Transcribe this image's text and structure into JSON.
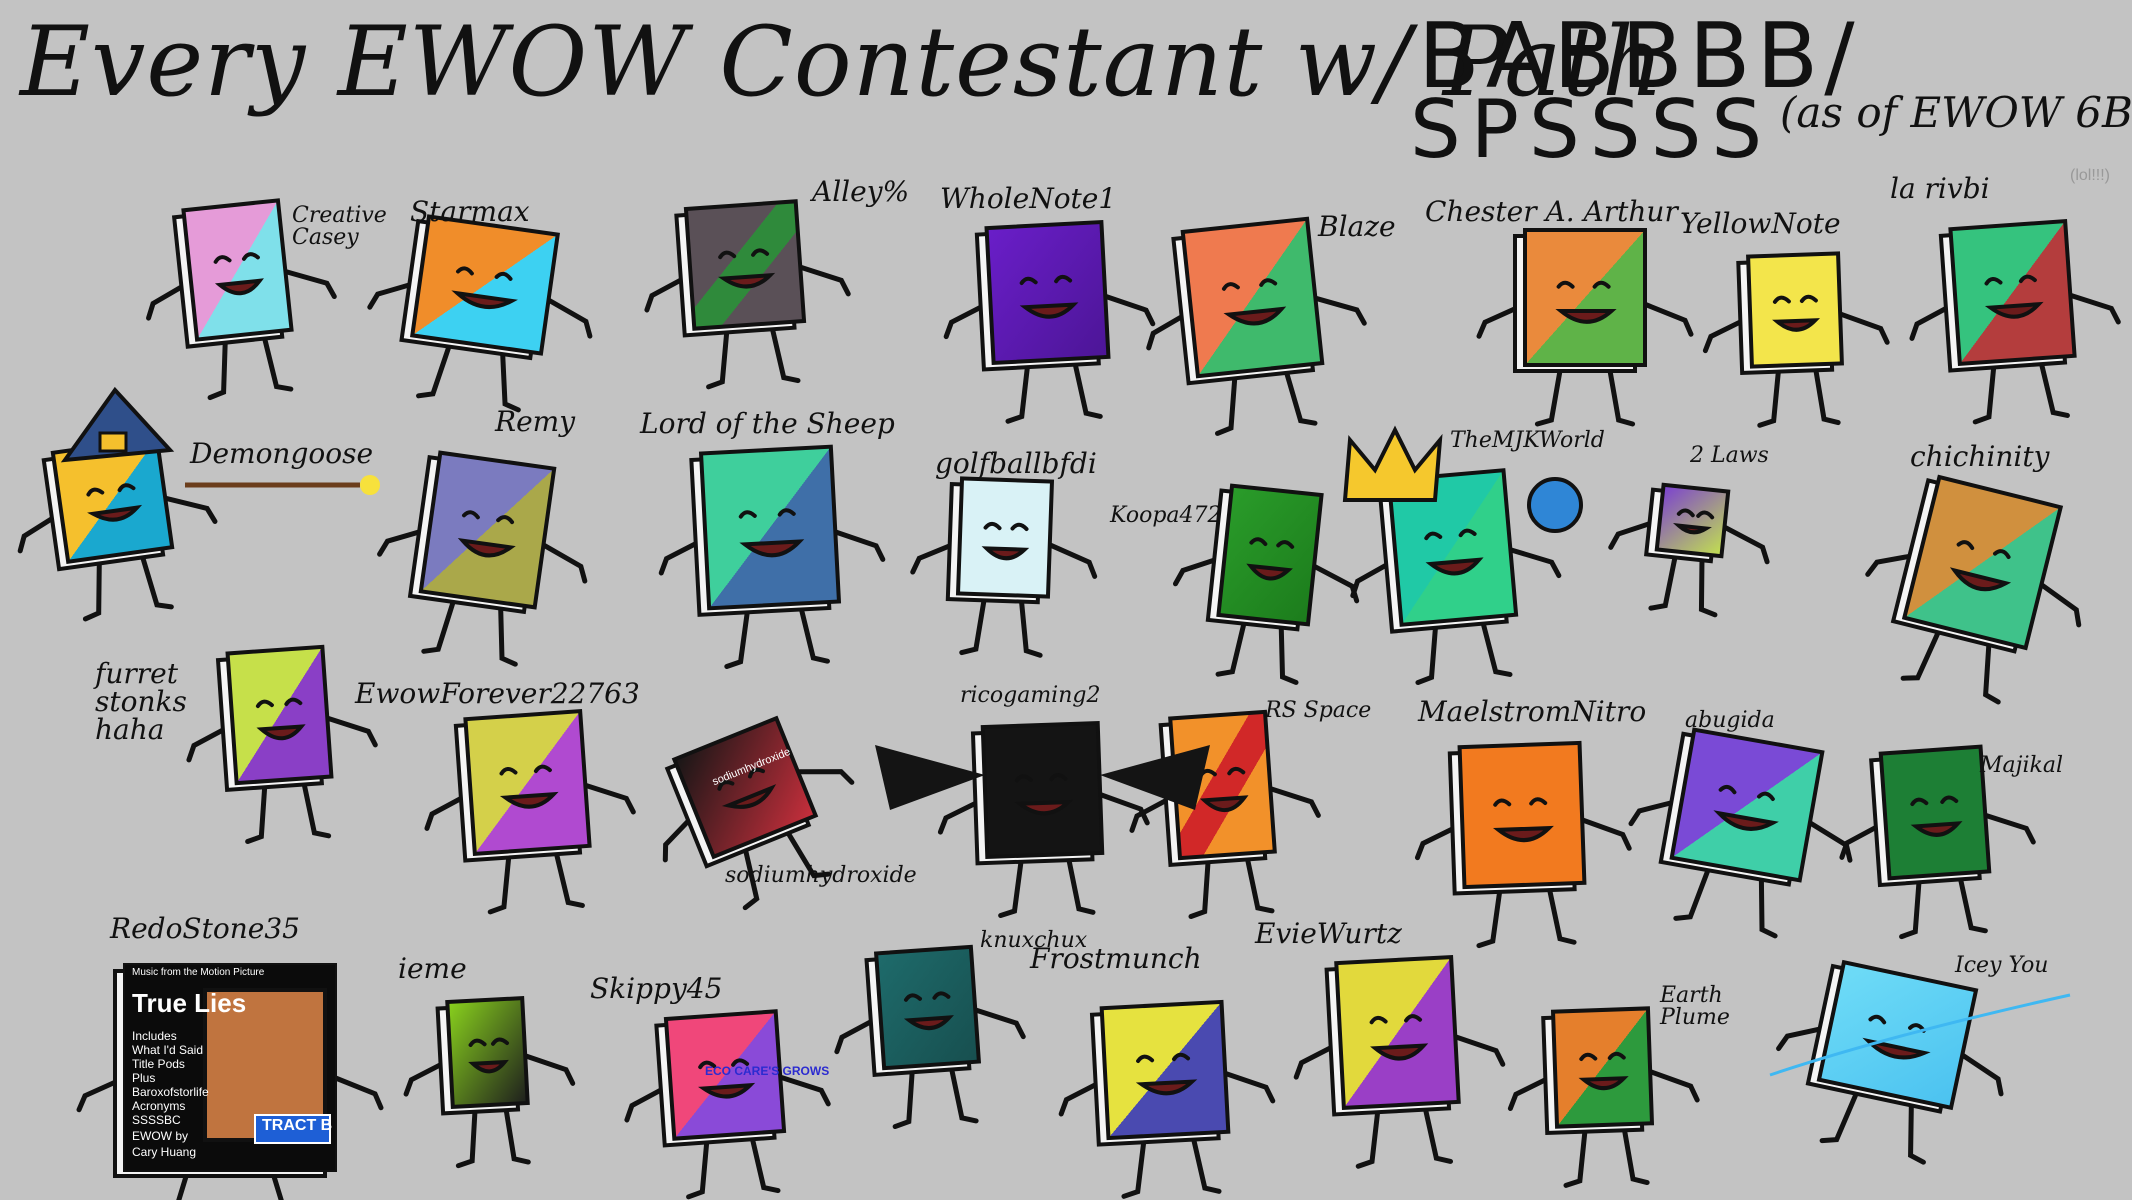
{
  "title": {
    "line1": "Every EWOW Contestant w/ Path",
    "path_top": "BABBBB/",
    "path_bottom": "SPSSSS",
    "note": "(as of EWOW 6B)"
  },
  "extra_text": {
    "lol": "(lol!!!)",
    "cover_line1": "Music from the Motion Picture",
    "cover_title": "True Lies",
    "cover_body": [
      "Includes",
      "What I'd Said",
      "Title Pods",
      "Plus",
      "Baroxofstorlife",
      "Acronyms",
      "SSSSBC"
    ],
    "cover_footer": [
      "EWOW by",
      "Cary Huang"
    ],
    "tract_badge": "TRACT B",
    "skippy_cover": "ECO CARE'S GROWS",
    "sodium_cover": "sodiumhydroxide"
  },
  "characters": [
    {
      "id": "creative-casey",
      "label": "Creative\nCasey",
      "colors": [
        "#e59bd8",
        "#7fe0ea"
      ],
      "split": "diag"
    },
    {
      "id": "starmax",
      "label": "Starmax",
      "colors": [
        "#f08d2a",
        "#3dd1f2"
      ],
      "split": "diag"
    },
    {
      "id": "alley",
      "label": "Alley%",
      "colors": [
        "#5a5057",
        "#2f8a3b"
      ],
      "split": "band"
    },
    {
      "id": "wholenote1",
      "label": "WholeNote1",
      "colors": [
        "#6a1ec9",
        "#4c1596"
      ],
      "split": "solid"
    },
    {
      "id": "blaze",
      "label": "Blaze",
      "colors": [
        "#ef7a4f",
        "#3fba6c"
      ],
      "split": "diag"
    },
    {
      "id": "chester",
      "label": "Chester A. Arthur",
      "colors": [
        "#ea8a3c",
        "#5fb348"
      ],
      "split": "diag"
    },
    {
      "id": "yellownote",
      "label": "YellowNote",
      "colors": [
        "#f3e54b",
        "#f3e54b"
      ],
      "split": "solid"
    },
    {
      "id": "la-rivbi",
      "label": "la rivbi",
      "colors": [
        "#35c37e",
        "#b43d3d"
      ],
      "split": "diag"
    },
    {
      "id": "demongoose",
      "label": "Demongoose",
      "colors": [
        "#f5c02d",
        "#1aa8cf"
      ],
      "split": "diag"
    },
    {
      "id": "remy",
      "label": "Remy",
      "colors": [
        "#7b7bbf",
        "#aaa84a"
      ],
      "split": "diag"
    },
    {
      "id": "lord-sheep",
      "label": "Lord of the Sheep",
      "colors": [
        "#3fcf9c",
        "#3f6fa8"
      ],
      "split": "diag"
    },
    {
      "id": "golfball",
      "label": "golfballbfdi",
      "colors": [
        "#d9f2f6",
        "#d9f2f6"
      ],
      "split": "solid"
    },
    {
      "id": "koopa472",
      "label": "Koopa472",
      "colors": [
        "#2a9c2a",
        "#1c7c1c"
      ],
      "split": "solid"
    },
    {
      "id": "themjk",
      "label": "TheMJKWorld",
      "colors": [
        "#20c9a6",
        "#30d08a"
      ],
      "split": "diag"
    },
    {
      "id": "2laws",
      "label": "2 Laws",
      "colors": [
        "#7a3fd2",
        "#c3e24e"
      ],
      "split": "solid"
    },
    {
      "id": "chichinity",
      "label": "chichinity",
      "colors": [
        "#d0903e",
        "#3fc28a"
      ],
      "split": "diag"
    },
    {
      "id": "furret",
      "label": "furret\nstonks\nhaha",
      "colors": [
        "#c6e04a",
        "#8a3fc6"
      ],
      "split": "diag"
    },
    {
      "id": "ewowforever",
      "label": "EwowForever22763",
      "colors": [
        "#d4d04a",
        "#b04ad0"
      ],
      "split": "diag"
    },
    {
      "id": "sodiumhydroxide",
      "label": "sodiumhydroxide",
      "colors": [
        "#161616",
        "#c92f3c"
      ],
      "split": "solid"
    },
    {
      "id": "ricogaming2",
      "label": "ricogaming2",
      "colors": [
        "#141414",
        "#141414"
      ],
      "split": "solid"
    },
    {
      "id": "rs-space",
      "label": "RS Space",
      "colors": [
        "#f2912a",
        "#d12828"
      ],
      "split": "band"
    },
    {
      "id": "maelstrom",
      "label": "MaelstromNitro",
      "colors": [
        "#f27a1f",
        "#f27a1f"
      ],
      "split": "solid"
    },
    {
      "id": "abugida",
      "label": "abugida",
      "colors": [
        "#7a4ad6",
        "#3fcfa8"
      ],
      "split": "diag"
    },
    {
      "id": "majikal",
      "label": "Majikal",
      "colors": [
        "#1d7f35",
        "#1d7f35"
      ],
      "split": "solid"
    },
    {
      "id": "redostone",
      "label": "RedoStone35",
      "colors": [
        "#c0743f",
        "#c0743f"
      ],
      "split": "solid"
    },
    {
      "id": "ieme",
      "label": "ieme",
      "colors": [
        "#8ad31d",
        "#1d1d1d"
      ],
      "split": "solid"
    },
    {
      "id": "skippy45",
      "label": "Skippy45",
      "colors": [
        "#f0477a",
        "#8a4ad8"
      ],
      "split": "diag"
    },
    {
      "id": "knuxchux",
      "label": "knuxchux",
      "colors": [
        "#1e6b6b",
        "#174f4f"
      ],
      "split": "solid"
    },
    {
      "id": "frostmunch",
      "label": "Frostmunch",
      "colors": [
        "#e6e23f",
        "#4a4ab0"
      ],
      "split": "diag"
    },
    {
      "id": "eviewurtz",
      "label": "EvieWurtz",
      "colors": [
        "#e2d93c",
        "#9a3fc6"
      ],
      "split": "diag"
    },
    {
      "id": "earth-plume",
      "label": "Earth\nPlume",
      "colors": [
        "#e57f2c",
        "#2d9a3d"
      ],
      "split": "diag"
    },
    {
      "id": "icey-you",
      "label": "Icey You",
      "colors": [
        "#6fdcf7",
        "#4bc2f0"
      ],
      "split": "solid"
    }
  ]
}
